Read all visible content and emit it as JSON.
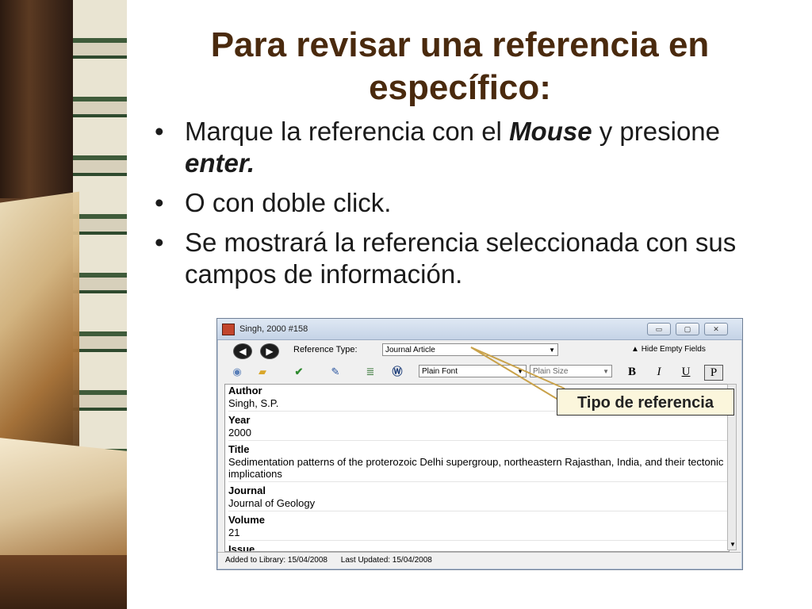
{
  "slide": {
    "title": "Para revisar una referencia en específico:",
    "bullet_marker": "•",
    "bullets": [
      {
        "before": "Marque la referencia con el ",
        "emph1": "Mouse",
        "middle": " y presione ",
        "emph2": "enter.",
        "after": ""
      },
      {
        "text": "O con doble click."
      },
      {
        "text": "Se mostrará la referencia seleccionada con sus campos de información."
      }
    ]
  },
  "window": {
    "title": "Singh, 2000 #158",
    "controls": {
      "minimize": "▭",
      "maximize": "▢",
      "close": "✕"
    },
    "nav": {
      "back": "◀",
      "forward": "▶"
    },
    "reference_type_label": "Reference Type:",
    "reference_type_value": "Journal Article",
    "hide_empty_fields": "Hide Empty Fields",
    "font_value": "Plain Font",
    "size_value": "Plain Size",
    "format_buttons": {
      "bold": "B",
      "italic": "I",
      "underline": "U",
      "plain": "P"
    },
    "fields": [
      {
        "label": "Author",
        "value": "Singh, S.P."
      },
      {
        "label": "Year",
        "value": "2000"
      },
      {
        "label": "Title",
        "value": "Sedimentation patterns of the proterozoic Delhi supergroup, northeastern Rajasthan, India, and their tectonic implications"
      },
      {
        "label": "Journal",
        "value": "Journal of Geology"
      },
      {
        "label": "Volume",
        "value": "21"
      },
      {
        "label": "Issue",
        "value": ""
      }
    ],
    "status": {
      "added": "Added to Library: 15/04/2008",
      "updated": "Last Updated: 15/04/2008"
    }
  },
  "callout": {
    "text": "Tipo de referencia"
  },
  "colors": {
    "title": "#4a2a0e",
    "callout_bg": "#fbf6dc"
  }
}
